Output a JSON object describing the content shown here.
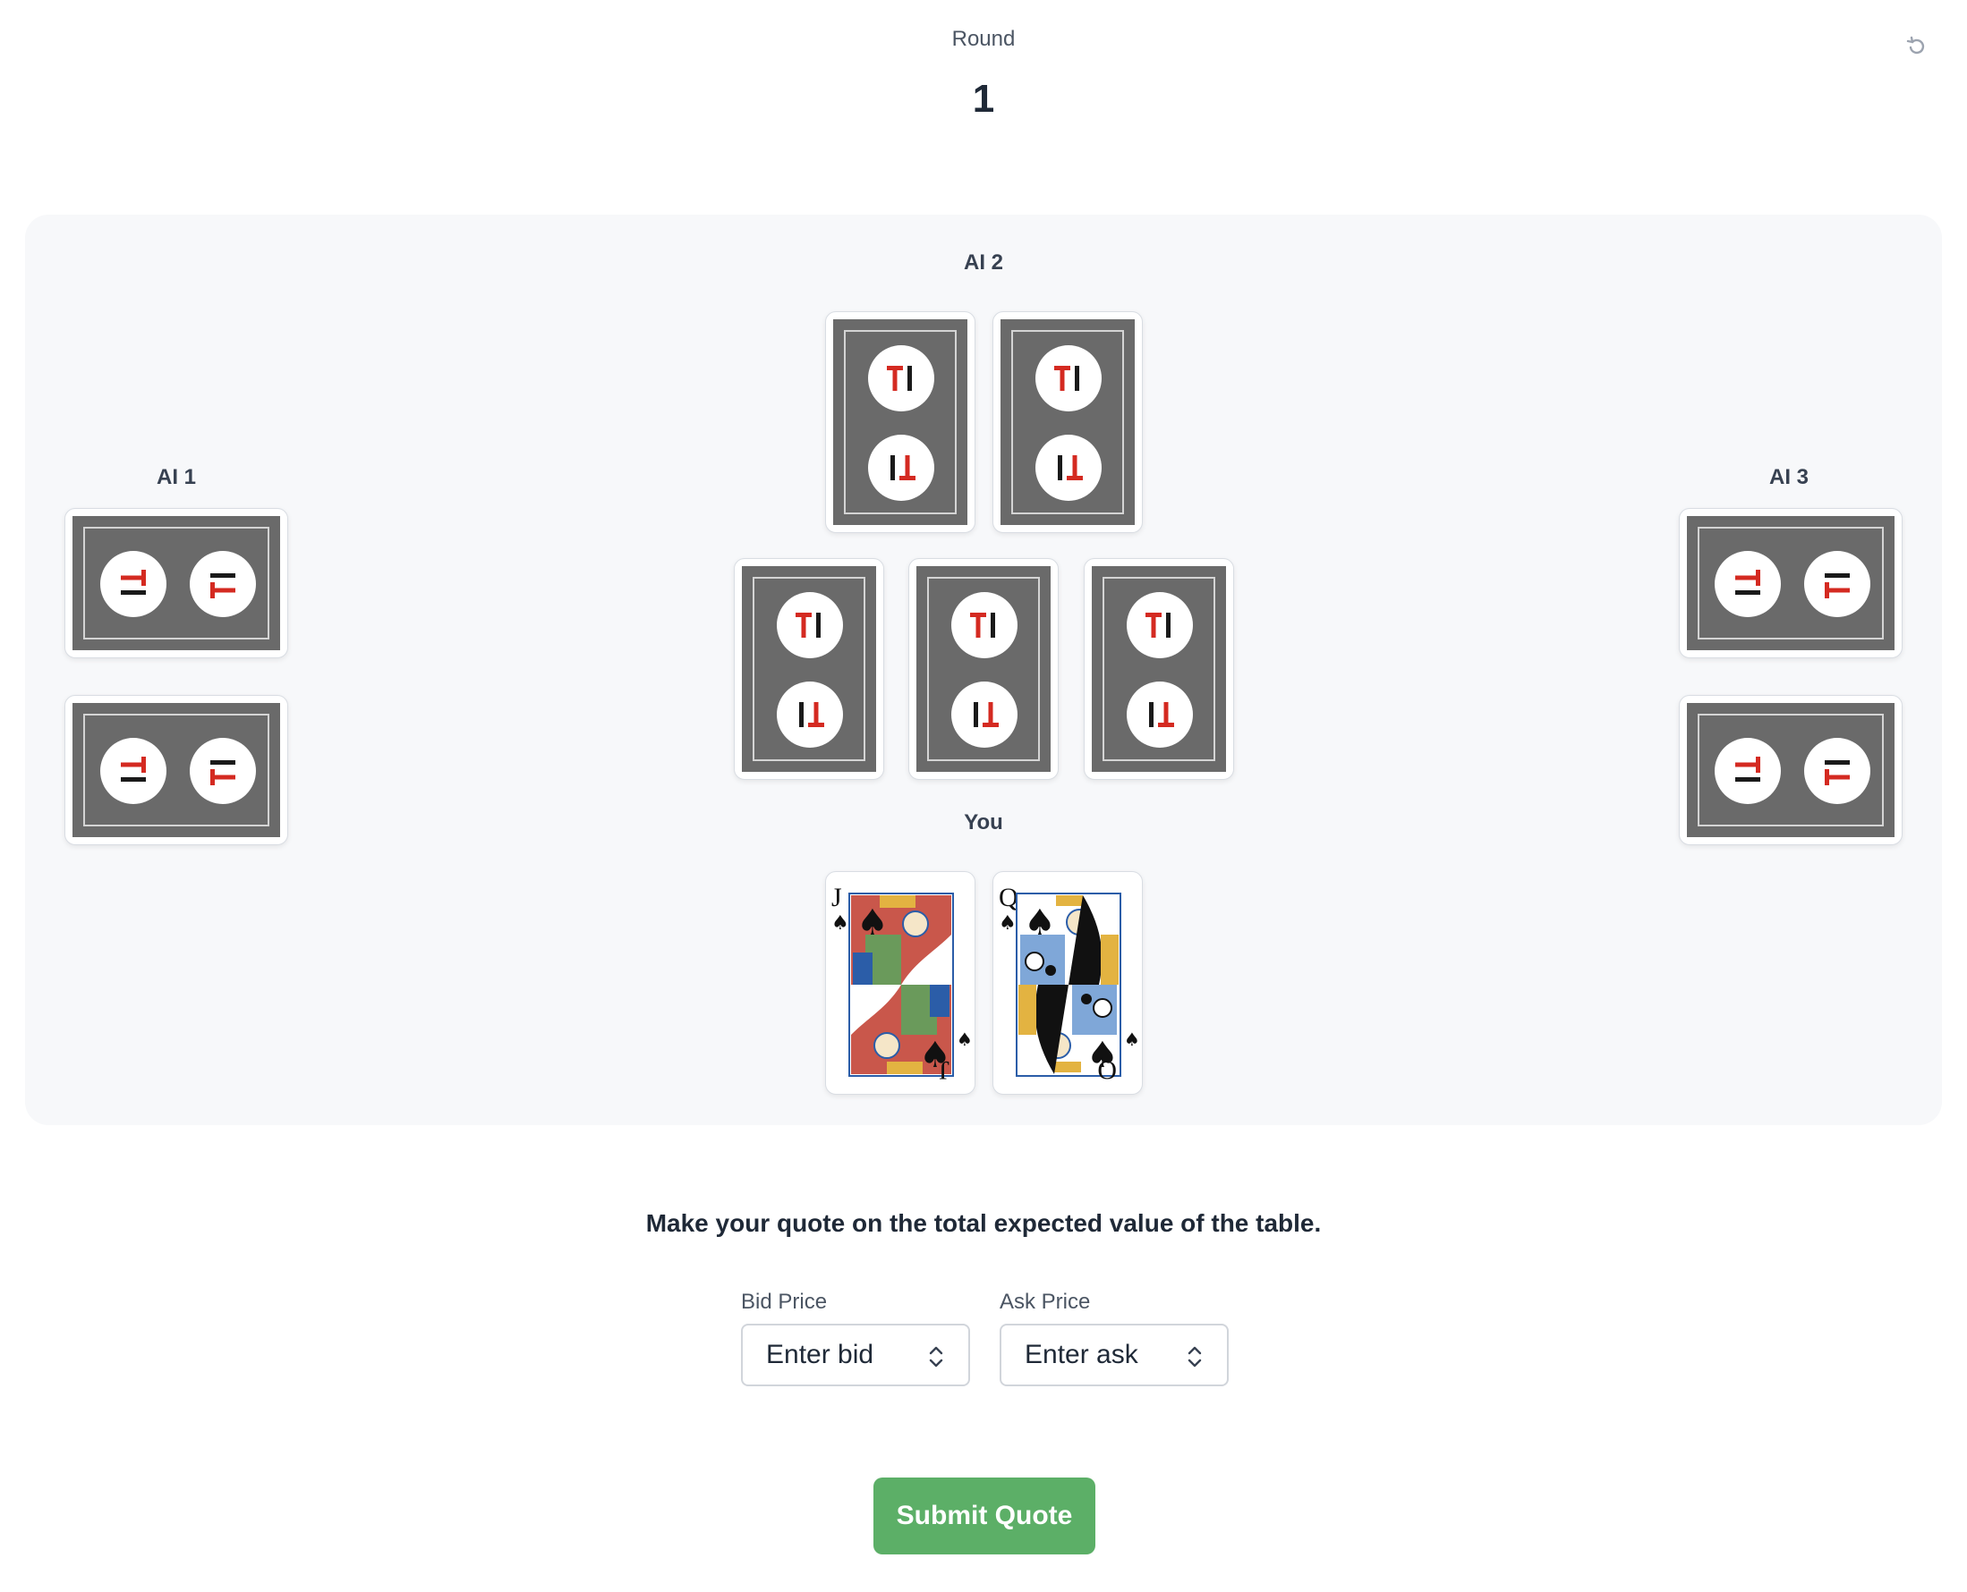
{
  "header": {
    "round_label": "Round",
    "round_number": "1",
    "reset_icon": "reset-icon"
  },
  "players": {
    "ai1": {
      "label": "AI 1",
      "cards_face_down": 2
    },
    "ai2": {
      "label": "AI 2",
      "cards_face_down": 2
    },
    "ai3": {
      "label": "AI 3",
      "cards_face_down": 2
    },
    "you": {
      "label": "You",
      "cards": [
        {
          "rank": "J",
          "suit": "spades"
        },
        {
          "rank": "Q",
          "suit": "spades"
        }
      ]
    }
  },
  "community": {
    "cards_face_down": 3
  },
  "card_back": {
    "logo_text": "TI",
    "color": "#6a6a6a",
    "logo_red": "#d42a21"
  },
  "quote": {
    "prompt": "Make your quote on the total expected value of the table.",
    "bid_label": "Bid Price",
    "bid_placeholder": "Enter bid",
    "ask_label": "Ask Price",
    "ask_placeholder": "Enter ask",
    "submit_label": "Submit Quote"
  },
  "colors": {
    "table_bg": "#f7f8fa",
    "submit_bg": "#5caf67"
  }
}
